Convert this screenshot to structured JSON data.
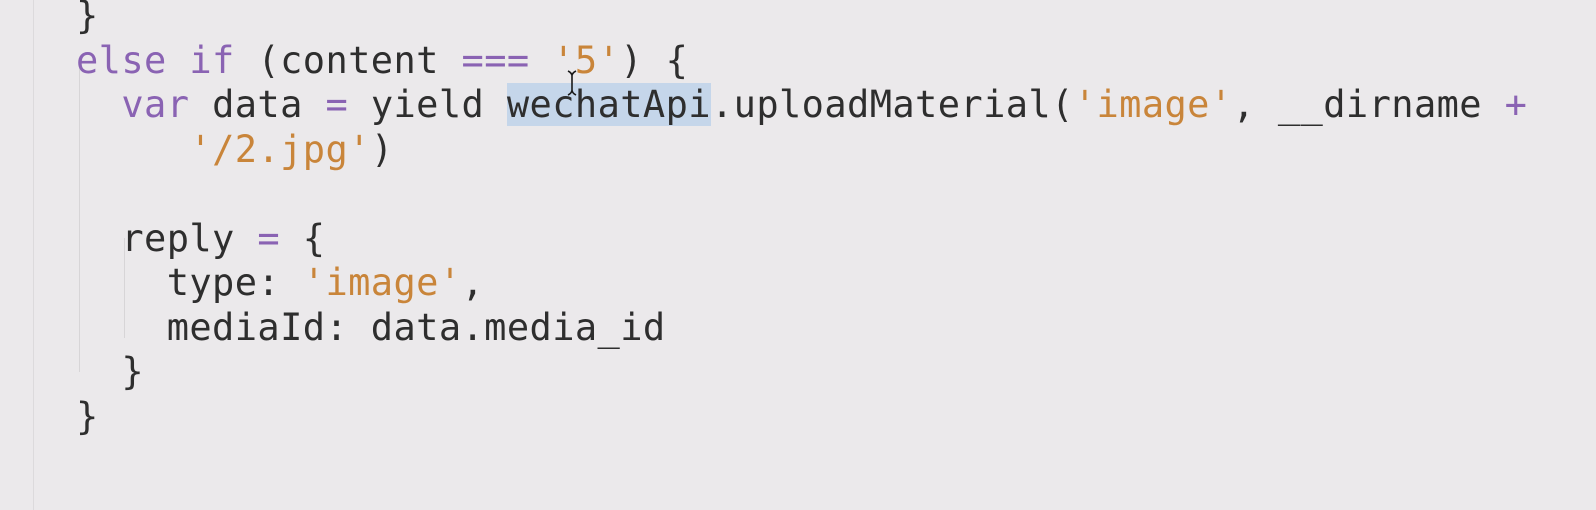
{
  "editor": {
    "lines": [
      {
        "id": "line-top-brace",
        "tokens": [
          {
            "t": "}",
            "c": "plain"
          }
        ]
      },
      {
        "id": "line-else-if",
        "tokens": [
          {
            "t": "else if ",
            "c": "kw"
          },
          {
            "t": "(content ",
            "c": "plain"
          },
          {
            "t": "===",
            "c": "op"
          },
          {
            "t": " ",
            "c": "plain"
          },
          {
            "t": "'5'",
            "c": "str"
          },
          {
            "t": ") {",
            "c": "plain"
          }
        ]
      },
      {
        "id": "line-var-data",
        "tokens": [
          {
            "t": "  ",
            "c": "plain"
          },
          {
            "t": "var",
            "c": "kw"
          },
          {
            "t": " data ",
            "c": "plain"
          },
          {
            "t": "=",
            "c": "op"
          },
          {
            "t": " yield ",
            "c": "plain"
          },
          {
            "t": "wechatApi",
            "c": "plain",
            "sel": true
          },
          {
            "t": ".uploadMaterial(",
            "c": "plain"
          },
          {
            "t": "'image'",
            "c": "str"
          },
          {
            "t": ", __dirname ",
            "c": "plain"
          },
          {
            "t": "+",
            "c": "op"
          }
        ]
      },
      {
        "id": "line-jpg",
        "tokens": [
          {
            "t": "     ",
            "c": "plain"
          },
          {
            "t": "'/2.jpg'",
            "c": "str"
          },
          {
            "t": ")",
            "c": "plain"
          }
        ]
      },
      {
        "id": "line-blank",
        "tokens": []
      },
      {
        "id": "line-reply",
        "tokens": [
          {
            "t": "  reply ",
            "c": "plain"
          },
          {
            "t": "=",
            "c": "op"
          },
          {
            "t": " {",
            "c": "plain"
          }
        ]
      },
      {
        "id": "line-type",
        "tokens": [
          {
            "t": "    type: ",
            "c": "plain"
          },
          {
            "t": "'image'",
            "c": "str"
          },
          {
            "t": ",",
            "c": "plain"
          }
        ]
      },
      {
        "id": "line-mediaid",
        "tokens": [
          {
            "t": "    mediaId: data.media_id",
            "c": "plain"
          }
        ]
      },
      {
        "id": "line-close-reply",
        "tokens": [
          {
            "t": "  }",
            "c": "plain"
          }
        ]
      },
      {
        "id": "line-close-else",
        "tokens": [
          {
            "t": "}",
            "c": "plain"
          }
        ]
      }
    ]
  },
  "icons": {
    "cursor": "text-cursor-icon"
  }
}
